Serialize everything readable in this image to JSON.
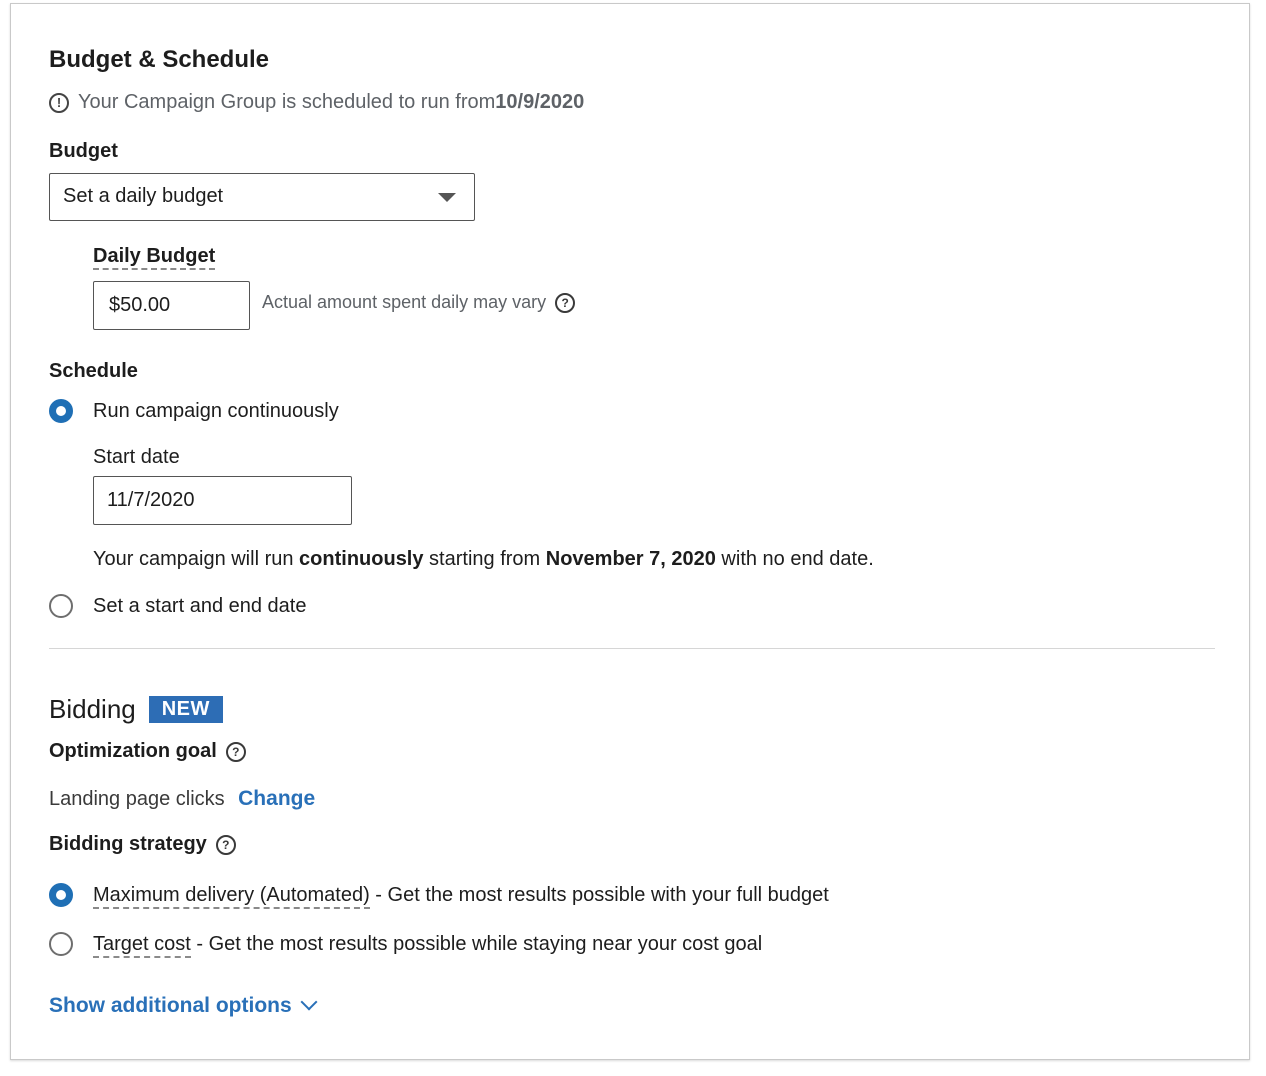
{
  "budget_schedule": {
    "title": "Budget & Schedule",
    "notice_prefix": "Your Campaign Group is scheduled to run from ",
    "notice_date": "10/9/2020",
    "budget_label": "Budget",
    "budget_select_value": "Set a daily budget",
    "daily_budget_label": "Daily Budget",
    "daily_budget_value": "$50.00",
    "daily_budget_hint": "Actual amount spent daily may vary",
    "schedule_label": "Schedule",
    "options": {
      "continuous": {
        "label": "Run campaign continuously",
        "selected": true
      },
      "start_end": {
        "label": "Set a start and end date",
        "selected": false
      }
    },
    "start_date_label": "Start date",
    "start_date_value": "11/7/2020",
    "summary": {
      "part1": "Your campaign will run ",
      "bold1": "continuously",
      "part2": " starting from ",
      "bold2": "November 7, 2020",
      "part3": " with no end date."
    }
  },
  "bidding": {
    "title": "Bidding",
    "badge": "NEW",
    "optimization_goal_label": "Optimization goal",
    "optimization_goal_value": "Landing page clicks",
    "change_link": "Change",
    "strategy_label": "Bidding strategy",
    "strategies": [
      {
        "name": "Maximum delivery (Automated)",
        "desc": " - Get the most results possible with your full budget",
        "selected": true
      },
      {
        "name": "Target cost",
        "desc": " - Get the most results possible while staying near your cost goal",
        "selected": false
      }
    ],
    "show_more": "Show additional options"
  },
  "icons": {
    "info": "info-circle-icon",
    "help": "question-circle-icon",
    "caret": "caret-down-icon",
    "chevron": "chevron-down-icon"
  },
  "colors": {
    "accent": "#2970b8",
    "badge": "#2d6db5",
    "radio_selected": "#1f6fb5"
  }
}
